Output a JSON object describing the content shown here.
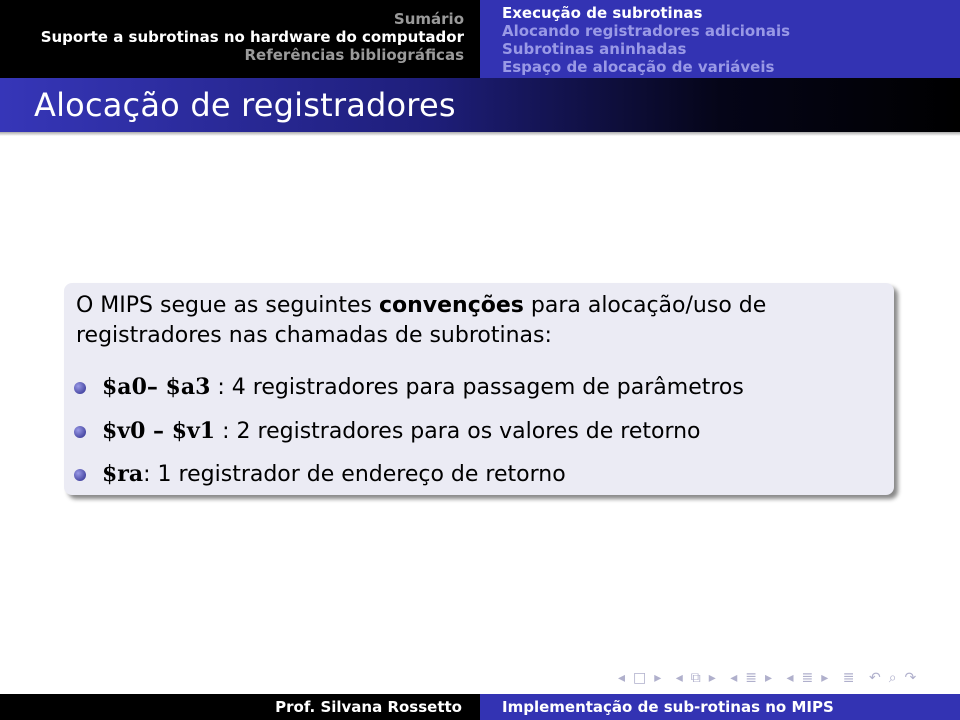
{
  "header": {
    "sections": [
      {
        "label": "Sumário",
        "active": false
      },
      {
        "label": "Suporte a subrotinas no hardware do computador",
        "active": true
      },
      {
        "label": "Referências bibliográficas",
        "active": false
      }
    ],
    "subsections": [
      {
        "label": "Execução de subrotinas",
        "active": true
      },
      {
        "label": "Alocando registradores adicionais",
        "active": false
      },
      {
        "label": "Subrotinas aninhadas",
        "active": false
      },
      {
        "label": "Espaço de alocação de variáveis",
        "active": false
      }
    ]
  },
  "slide": {
    "title": "Alocação de registradores",
    "intro_before": "O MIPS segue as seguintes ",
    "intro_bold": "convenções",
    "intro_after": " para alocação/uso de registradores nas chamadas de subrotinas:",
    "items": [
      {
        "reg": "$a0– $a3",
        "text": " : 4 registradores para passagem de parâmetros"
      },
      {
        "reg": "$v0 – $v1",
        "text": " : 2 registradores para os valores de retorno"
      },
      {
        "reg": "$ra",
        "text": ": 1 registrador de endereço de retorno"
      }
    ]
  },
  "navigation": {
    "icons": [
      "frame-prev-icon",
      "frame-icon",
      "frame-next-icon",
      "subsection-prev-icon",
      "subsection-icon",
      "subsection-next-icon",
      "section-prev-icon",
      "section-icon",
      "section-next-icon",
      "appendix-icon",
      "back-icon",
      "search-icon",
      "forward-icon"
    ]
  },
  "footer": {
    "author": "Prof. Silvana Rossetto",
    "title": "Implementação de sub-rotinas no MIPS"
  }
}
